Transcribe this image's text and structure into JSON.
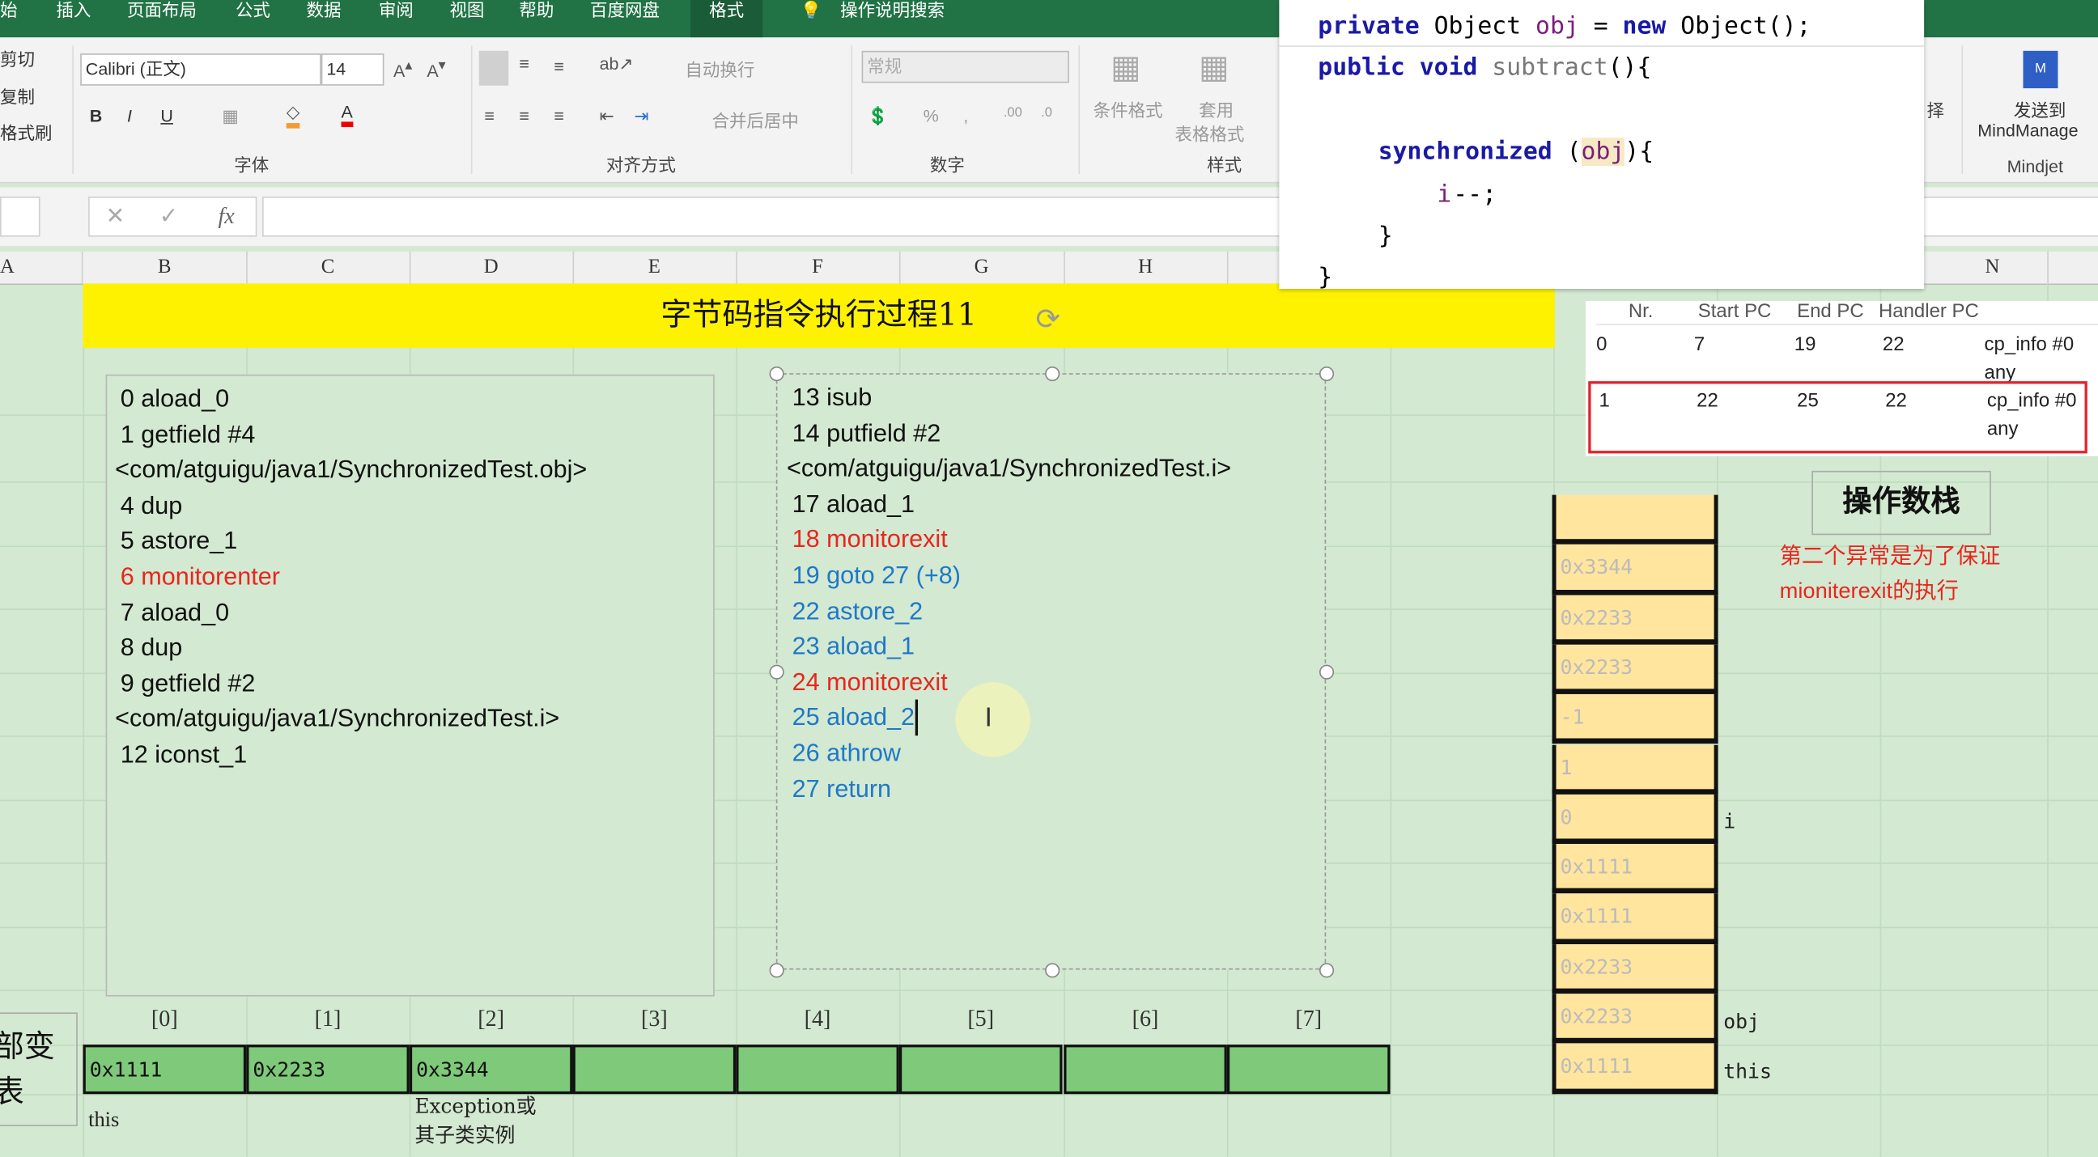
{
  "ribbon": {
    "tabs": [
      "始",
      "插入",
      "页面布局",
      "公式",
      "数据",
      "审阅",
      "视图",
      "帮助",
      "百度网盘",
      "格式"
    ],
    "search_hint": "操作说明搜索",
    "clipboard": [
      "剪切",
      "复制",
      "格式刷"
    ],
    "font_name": "Calibri (正文)",
    "font_size": "14",
    "wrap_text": "自动换行",
    "merge_center": "合并后居中",
    "number_format": "常规",
    "cond_format": "条件格式",
    "table_format_1": "套用",
    "table_format_2": "表格格式",
    "select_partial": "择",
    "send_to_1": "发送到",
    "send_to_2": "MindManage",
    "groups": {
      "font": "字体",
      "align": "对齐方式",
      "number": "数字",
      "style": "样式",
      "mindjet": "Mindjet"
    }
  },
  "formula_bar": {
    "fx": "fx",
    "cancel": "✕",
    "enter": "✓",
    "value": ""
  },
  "columns": [
    "A",
    "B",
    "C",
    "D",
    "E",
    "F",
    "G",
    "H",
    "N"
  ],
  "title": "字节码指令执行过程11",
  "left_instructions": [
    {
      "text": "0 aload_0",
      "color": "black"
    },
    {
      "text": "1 getfield #4",
      "color": "black"
    },
    {
      "text": "<com/atguigu/java1/SynchronizedTest.obj>",
      "color": "black"
    },
    {
      "text": "4 dup",
      "color": "black"
    },
    {
      "text": "5 astore_1",
      "color": "black"
    },
    {
      "text": "6 monitorenter",
      "color": "red"
    },
    {
      "text": "7 aload_0",
      "color": "black"
    },
    {
      "text": "8 dup",
      "color": "black"
    },
    {
      "text": "9 getfield #2",
      "color": "black"
    },
    {
      "text": "<com/atguigu/java1/SynchronizedTest.i>",
      "color": "black"
    },
    {
      "text": "12 iconst_1",
      "color": "black"
    }
  ],
  "right_instructions": [
    {
      "text": "13 isub",
      "color": "black"
    },
    {
      "text": "14 putfield #2",
      "color": "black"
    },
    {
      "text": "<com/atguigu/java1/SynchronizedTest.i>",
      "color": "black"
    },
    {
      "text": "17 aload_1",
      "color": "black"
    },
    {
      "text": "18 monitorexit",
      "color": "red"
    },
    {
      "text": "19 goto 27 (+8)",
      "color": "blue"
    },
    {
      "text": "22 astore_2",
      "color": "blue"
    },
    {
      "text": "23 aload_1",
      "color": "blue"
    },
    {
      "text": "24 monitorexit",
      "color": "red"
    },
    {
      "text": "25 aload_2",
      "color": "blue"
    },
    {
      "text": "26 athrow",
      "color": "blue"
    },
    {
      "text": "27 return",
      "color": "blue"
    }
  ],
  "code": {
    "l1": {
      "kw1": "private",
      "t1": " Object ",
      "v": "obj",
      "t2": " = ",
      "kw2": "new",
      "t3": " Object();"
    },
    "l2": {
      "kw1": "public",
      "kw2": " void ",
      "m": "subtract",
      "t": "(){"
    },
    "l3": {
      "kw": "synchronized",
      "t1": " (",
      "v": "obj",
      "t2": "){"
    },
    "l4": {
      "v": "i",
      "t": "--;"
    },
    "l5": "}",
    "l6": "}"
  },
  "exception_table": {
    "headers": [
      "Nr.",
      "Start PC",
      "End PC",
      "Handler PC"
    ],
    "rows": [
      [
        "0",
        "7",
        "19",
        "22",
        "cp_info #0",
        "any"
      ],
      [
        "1",
        "22",
        "25",
        "22",
        "cp_info #0",
        "any"
      ]
    ]
  },
  "operand_stack": {
    "title": "操作数栈",
    "note_1": "第二个异常是为了保证",
    "note_2": "mioniterexit的执行",
    "cells": [
      "",
      "0x3344",
      "0x2233",
      "0x2233",
      "-1",
      "1",
      "0",
      "0x1111",
      "0x1111",
      "0x2233",
      "0x2233",
      "0x1111"
    ],
    "labels": {
      "i": "i",
      "obj": "obj",
      "this": "this"
    }
  },
  "local_vars": {
    "title_1": "部变",
    "title_2": "表",
    "indices": [
      "[0]",
      "[1]",
      "[2]",
      "[3]",
      "[4]",
      "[5]",
      "[6]",
      "[7]"
    ],
    "values": [
      "0x1111",
      "0x2233",
      "0x3344",
      "",
      "",
      "",
      "",
      ""
    ],
    "note_this": "this",
    "note_exc_1": "Exception或",
    "note_exc_2": "其子类实例"
  },
  "colors": {
    "ribbon_green": "#217346",
    "highlight_yellow": "#fff200",
    "stack_fill": "#ffe59e",
    "local_fill": "#7fc97a",
    "red": "#e8261f",
    "blue": "#1f78c8"
  }
}
